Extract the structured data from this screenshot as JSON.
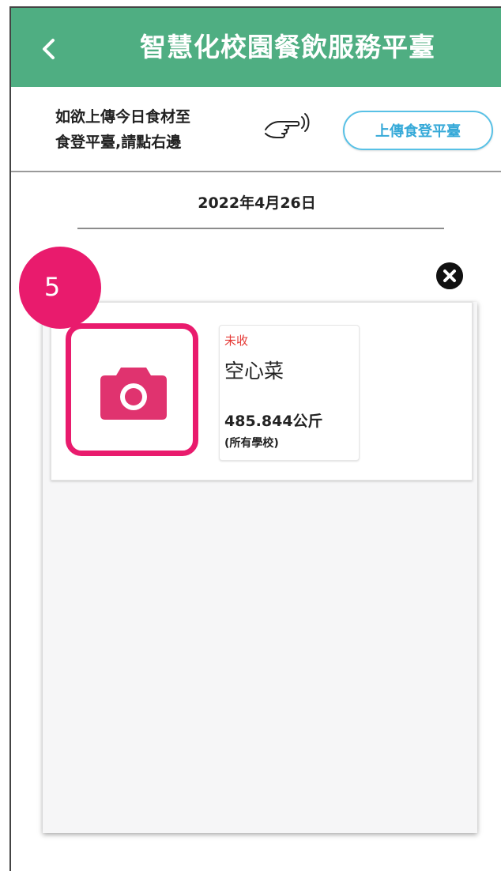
{
  "header": {
    "back_icon": "chevron-left-icon",
    "title": "智慧化校園餐飲服務平臺",
    "color": "#4fae82"
  },
  "upload": {
    "hint_line1": "如欲上傳今日食材至",
    "hint_line2": "食登平臺,請點右邊",
    "hand_icon": "pointing-hand-icon",
    "button_label": "上傳食登平臺",
    "button_color": "#35a9d8"
  },
  "date": "2022年4月26日",
  "step_badge": "5",
  "close_icon": "close-circle-icon",
  "item": {
    "photo_icon": "camera-icon",
    "status": "未收",
    "name": "空心菜",
    "weight": "485.844公斤",
    "scope": "(所有學校)",
    "accent_color": "#e91b6d",
    "status_color": "#e53935"
  }
}
